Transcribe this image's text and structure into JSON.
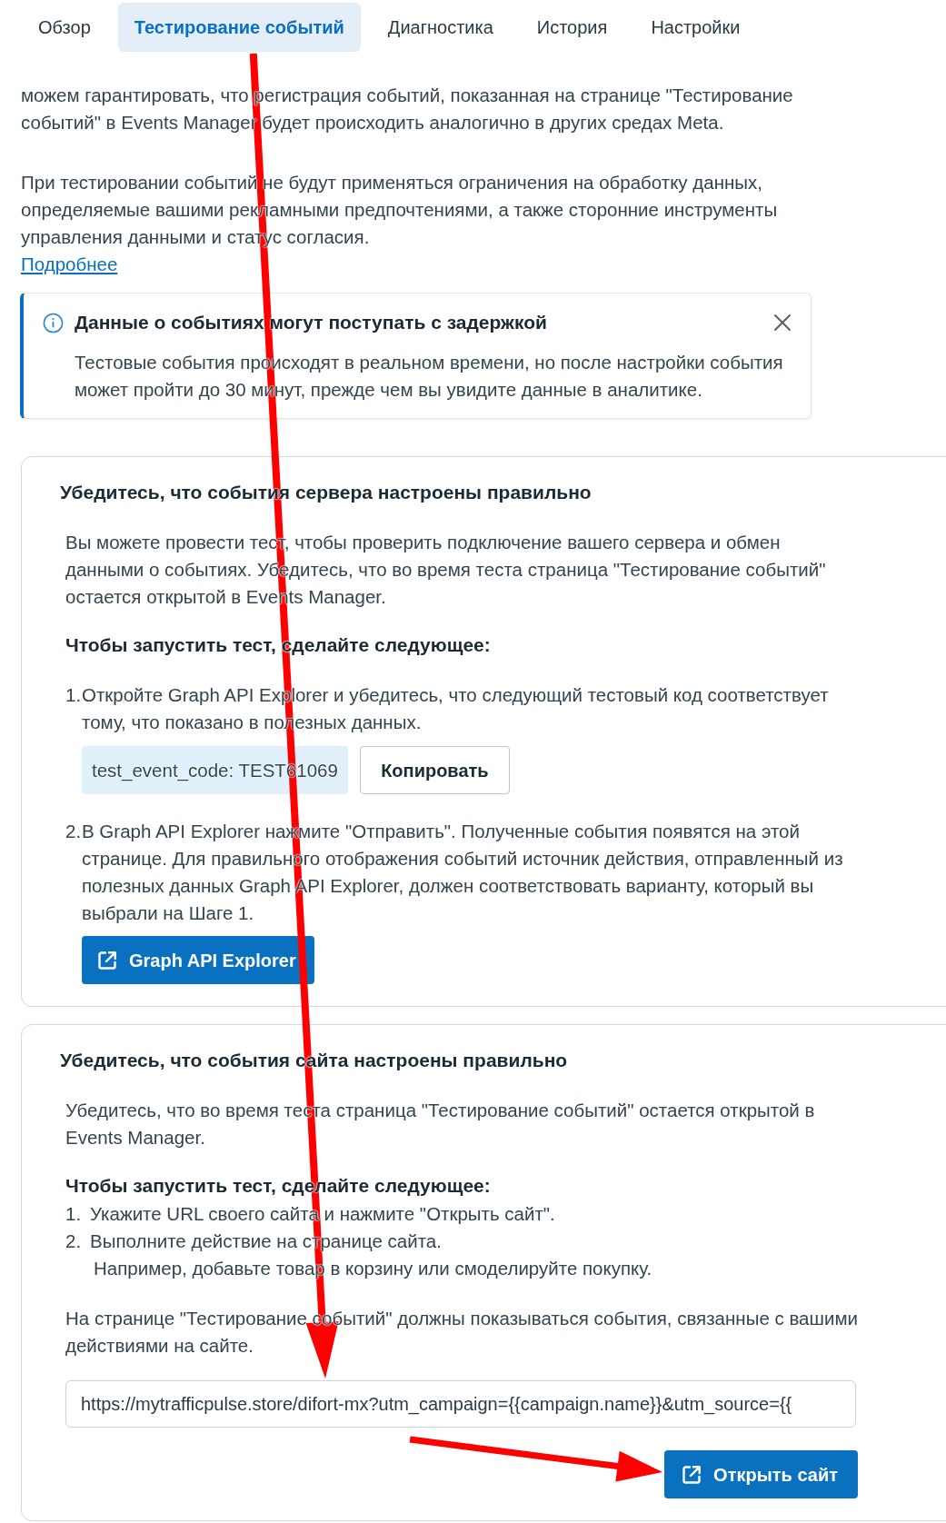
{
  "tabs": [
    {
      "label": "Обзор",
      "selected": false
    },
    {
      "label": "Тестирование событий",
      "selected": true
    },
    {
      "label": "Диагностика",
      "selected": false
    },
    {
      "label": "История",
      "selected": false
    },
    {
      "label": "Настройки",
      "selected": false
    }
  ],
  "intro": {
    "paragraphs": [
      "можем гарантировать, что регистрация событий, показанная на странице \"Тестирование событий\" в Events Manager будет происходить аналогично в других средах Meta.",
      "При тестировании событий не будут применяться ограничения на обработку данных, определяемые вашими рекламными предпочтениями, а также сторонние инструменты управления данными и статус согласия."
    ],
    "link": "Подробнее"
  },
  "notice": {
    "title": "Данные о событиях могут поступать с задержкой",
    "body": "Тестовые события происходят в реальном времени, но после настройки события может пройти до 30 минут, прежде чем вы увидите данные в аналитике."
  },
  "server_card": {
    "title": "Убедитесь, что события сервера настроены правильно",
    "description": "Вы можете провести тест, чтобы проверить подключение вашего сервера и обмен данными о событиях. Убедитесь, что во время теста страница \"Тестирование событий\" остается открытой в Events Manager.",
    "steps_heading": "Чтобы запустить тест, сделайте следующее:",
    "steps": [
      {
        "number": "1.",
        "text": "Откройте Graph API Explorer и убедитесь, что следующий тестовый код соответствует тому, что показано в полезных данных.",
        "code": "test_event_code: TEST61069",
        "copy_button": "Копировать"
      },
      {
        "number": "2.",
        "text": "В Graph API Explorer нажмите \"Отправить\". Полученные события появятся на этой странице. Для правильного отображения событий источник действия, отправленный из полезных данных Graph API Explorer, должен соответствовать варианту, который вы выбрали на Шаге 1.",
        "button": "Graph API Explorer"
      }
    ]
  },
  "website_card": {
    "title": "Убедитесь, что события сайта настроены правильно",
    "description": "Убедитесь, что во время теста страница \"Тестирование событий\" остается открытой в Events Manager.",
    "steps_heading": "Чтобы запустить тест, сделайте следующее:",
    "steps": [
      {
        "number": "1.",
        "text": "Укажите URL своего сайта и нажмите \"Открыть сайт\"."
      },
      {
        "number": "2.",
        "text": "Выполните действие на странице сайта.",
        "note": "Например, добавьте товар в корзину или смоделируйте покупку."
      }
    ],
    "result": "На странице \"Тестирование событий\" должны показываться события, связанные с вашими действиями на сайте.",
    "url_field": {
      "value": "https://mytrafficpulse.store/difort-mx?utm_campaign={{campaign.name}}&utm_source={{"
    },
    "button": "Открыть сайт"
  }
}
